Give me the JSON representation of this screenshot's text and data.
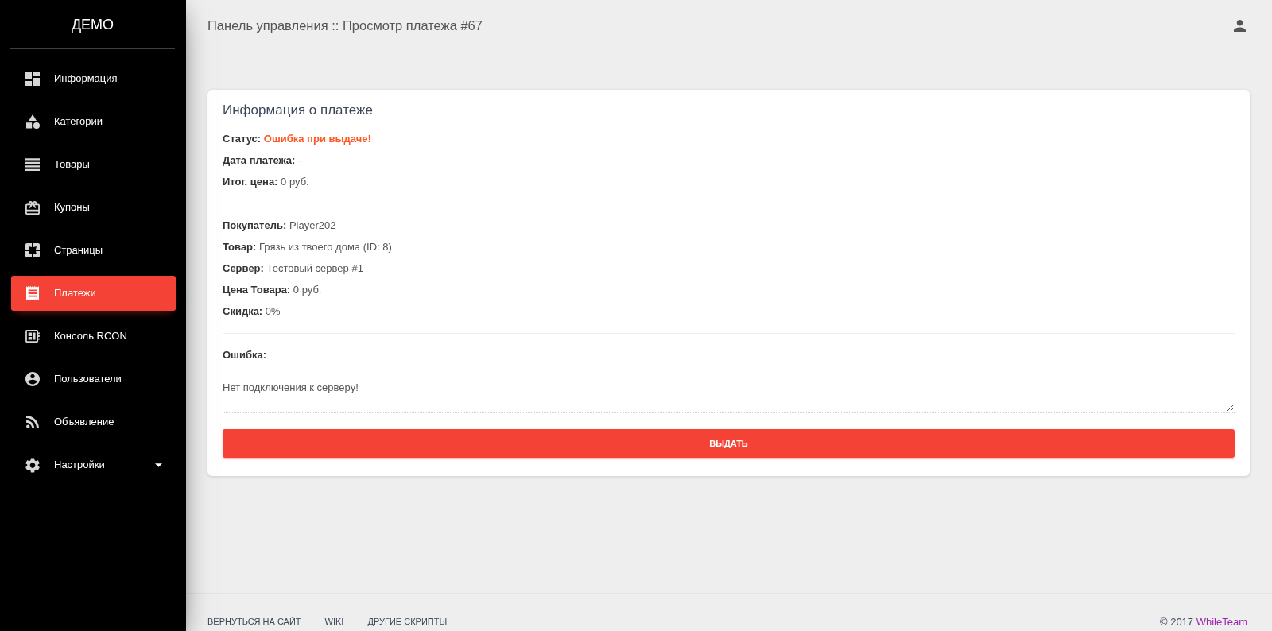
{
  "sidebar": {
    "brand": "ДЕМО",
    "items": [
      {
        "label": "Информация",
        "selected": false
      },
      {
        "label": "Категории",
        "selected": false
      },
      {
        "label": "Товары",
        "selected": false
      },
      {
        "label": "Купоны",
        "selected": false
      },
      {
        "label": "Страницы",
        "selected": false
      },
      {
        "label": "Платежи",
        "selected": true
      },
      {
        "label": "Консоль RCON",
        "selected": false
      },
      {
        "label": "Пользователи",
        "selected": false
      },
      {
        "label": "Объявление",
        "selected": false
      },
      {
        "label": "Настройки",
        "selected": false,
        "expanded": false
      }
    ]
  },
  "header": {
    "title": "Панель управления :: Просмотр платежа #67"
  },
  "card": {
    "title": "Информация о платеже",
    "sections": [
      {
        "fields": [
          {
            "label": "Статус:",
            "value": "Ошибка при выдаче!",
            "kind": "error"
          },
          {
            "label": "Дата платежа:",
            "value": "-",
            "kind": "plain"
          },
          {
            "label": "Итог. цена:",
            "value": "0 руб.",
            "kind": "plain"
          }
        ]
      },
      {
        "fields": [
          {
            "label": "Покупатель:",
            "value": "Player202",
            "kind": "plain"
          },
          {
            "label": "Товар:",
            "value": "Грязь из твоего дома (ID: 8)",
            "kind": "plain"
          },
          {
            "label": "Сервер:",
            "value": "Тестовый сервер #1",
            "kind": "plain"
          },
          {
            "label": "Цена Товара:",
            "value": "0 руб.",
            "kind": "plain"
          },
          {
            "label": "Скидка:",
            "value": "0%",
            "kind": "plain"
          }
        ]
      }
    ],
    "error": {
      "label": "Ошибка:",
      "value": "Нет подключения к серверу!"
    },
    "button": "ВЫДАТЬ"
  },
  "footer": {
    "links": [
      "ВЕРНУТЬСЯ НА САЙТ",
      "WIKI",
      "ДРУГИЕ СКРИПТЫ"
    ],
    "copyright": "© 2017",
    "author": "WhileTeam"
  }
}
